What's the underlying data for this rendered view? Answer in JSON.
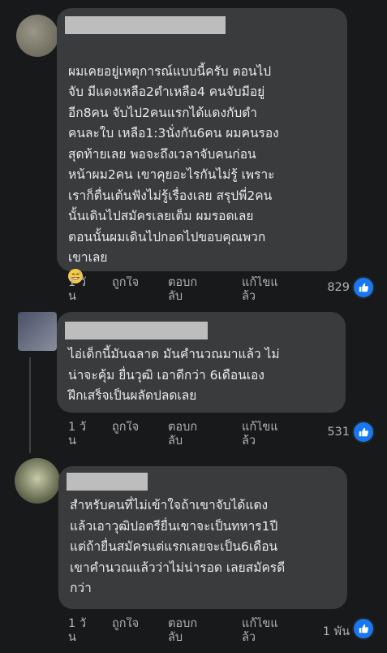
{
  "comments": [
    {
      "avatar_color": "#7c7a6a",
      "text": "ผมเคยอยู่เหตุการณ์แบบนี้ครับ ตอนไป\nจับ มีแดงเหลือ2ดำเหลือ4 คนจับมีอยู่\nอีก8คน จับไป2คนแรกได้แดงกับดำ\nคนละใบ เหลือ1:3นั่งกัน6คน ผมคนรอง\nสุดท้ายเลย พอจะถึงเวลาจับคนก่อน\nหน้าผม2คน เขาคุยอะไรกันไม่รู้ เพราะ\nเราก็ตื่นเต้นฟังไม่รู้เรื่องเลย สรุปพี่2คน\nนั้นเดินไปสมัครเลยเต็ม ผมรอดเลย\nตอนนั้นผมเดินไปกอดไปขอบคุณพวก\nเขาเลย",
      "emoji_icon": "smiling-face-with-sweat-icon",
      "time": "1 วัน",
      "like": "ถูกใจ",
      "reply": "ตอบกลับ",
      "edit": "แก้ไขแล้ว",
      "reactions": "829"
    },
    {
      "avatar_color": "#5a6072",
      "text": "ไอ่เด็กนี้มันฉลาด มันคำนวณมาแล้ว ไม่\nน่าจะคุ้ม ยื่นวุฒิ เอาดีกว่า 6เดือนเอง\nฝึกเสร็จเป็นผลัดปลดเลย",
      "time": "1 วัน",
      "like": "ถูกใจ",
      "reply": "ตอบกลับ",
      "edit": "แก้ไขแล้ว",
      "reactions": "531"
    },
    {
      "avatar_color": "#7a8060",
      "text": "สำหรับคนที่ไม่เข้าใจถ้าเขาจับได้แดง\nแล้วเอาวุฒิปอตรียื่นเขาจะเป็นทหาร1ปี\nแต่ถ้ายื่นสมัครแต่แรกเลยจะเป็น6เดือน\nเขาคำนวณแล้วว่าไม่น่ารอด เลยสมัครดี\nกว่า",
      "time": "1 วัน",
      "like": "ถูกใจ",
      "reply": "ตอบกลับ",
      "edit": "แก้ไขแล้ว",
      "reactions": "1 พัน"
    }
  ],
  "icons": {
    "like": "thumbs-up-icon"
  },
  "colors": {
    "background": "#18191a",
    "bubble": "#3a3b3c",
    "like_blue": "#1877f2",
    "muted": "#b0b3b8"
  }
}
